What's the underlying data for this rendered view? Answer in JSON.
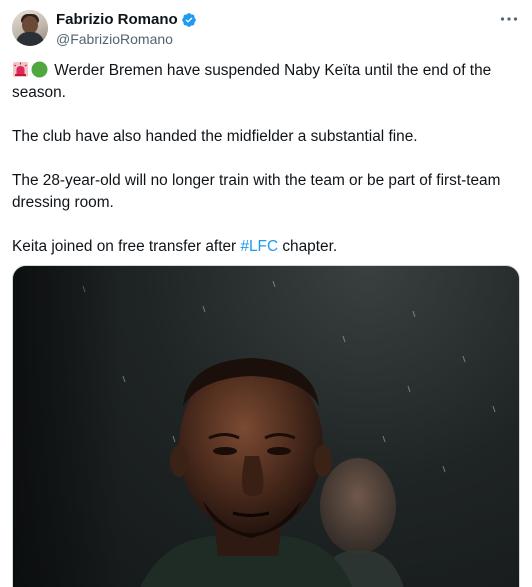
{
  "author": {
    "display_name": "Fabrizio Romano",
    "handle": "@FabrizioRomano",
    "verified": true
  },
  "tweet": {
    "paragraphs": [
      {
        "emojis": [
          "siren-icon",
          "green-circle-icon"
        ],
        "text": "Werder Bremen have suspended Naby Keïta until the end of the season."
      },
      {
        "text": "The club have also handed the midfielder a substantial fine."
      },
      {
        "text": "The 28-year-old will no longer train with the team or be part of first-team dressing room."
      },
      {
        "text_before": "Keita joined on free transfer after ",
        "hashtag": "#LFC",
        "text_after": " chapter."
      }
    ]
  },
  "colors": {
    "link": "#1d9bf0",
    "verified": "#1d9bf0",
    "secondary_text": "#536471"
  }
}
